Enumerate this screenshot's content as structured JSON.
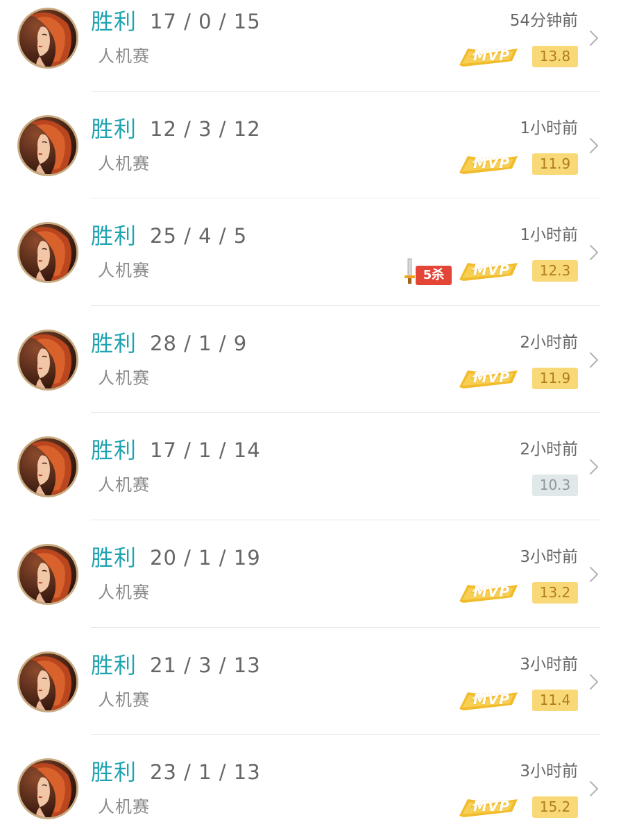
{
  "matches": [
    {
      "result": "胜利",
      "kda": "17 / 0 / 15",
      "mode": "人机赛",
      "time": "54分钟前",
      "mvp": true,
      "mvp_label": "MVP",
      "kill_badge": null,
      "score": "13.8",
      "score_style": "gold"
    },
    {
      "result": "胜利",
      "kda": "12 / 3 / 12",
      "mode": "人机赛",
      "time": "1小时前",
      "mvp": true,
      "mvp_label": "MVP",
      "kill_badge": null,
      "score": "11.9",
      "score_style": "gold"
    },
    {
      "result": "胜利",
      "kda": "25 / 4 / 5",
      "mode": "人机赛",
      "time": "1小时前",
      "mvp": true,
      "mvp_label": "MVP",
      "kill_badge": "5杀",
      "score": "12.3",
      "score_style": "gold"
    },
    {
      "result": "胜利",
      "kda": "28 / 1 / 9",
      "mode": "人机赛",
      "time": "2小时前",
      "mvp": true,
      "mvp_label": "MVP",
      "kill_badge": null,
      "score": "11.9",
      "score_style": "gold"
    },
    {
      "result": "胜利",
      "kda": "17 / 1 / 14",
      "mode": "人机赛",
      "time": "2小时前",
      "mvp": false,
      "mvp_label": "",
      "kill_badge": null,
      "score": "10.3",
      "score_style": "gray"
    },
    {
      "result": "胜利",
      "kda": "20 / 1 / 19",
      "mode": "人机赛",
      "time": "3小时前",
      "mvp": true,
      "mvp_label": "MVP",
      "kill_badge": null,
      "score": "13.2",
      "score_style": "gold"
    },
    {
      "result": "胜利",
      "kda": "21 / 3 / 13",
      "mode": "人机赛",
      "time": "3小时前",
      "mvp": true,
      "mvp_label": "MVP",
      "kill_badge": null,
      "score": "11.4",
      "score_style": "gold"
    },
    {
      "result": "胜利",
      "kda": "23 / 1 / 13",
      "mode": "人机赛",
      "time": "3小时前",
      "mvp": true,
      "mvp_label": "MVP",
      "kill_badge": null,
      "score": "15.2",
      "score_style": "gold"
    }
  ],
  "icons": {
    "avatar": "hero-portrait-icon",
    "chevron": "chevron-right-icon",
    "mvp": "mvp-badge-icon",
    "kill": "sword-icon"
  },
  "colors": {
    "result": "#1fa3b1",
    "score_gold_bg": "#f9d977",
    "score_gold_text": "#b07d1c",
    "score_gray_bg": "#e1e8ea",
    "score_gray_text": "#8e989c",
    "kill_badge_bg": "#e34536"
  }
}
